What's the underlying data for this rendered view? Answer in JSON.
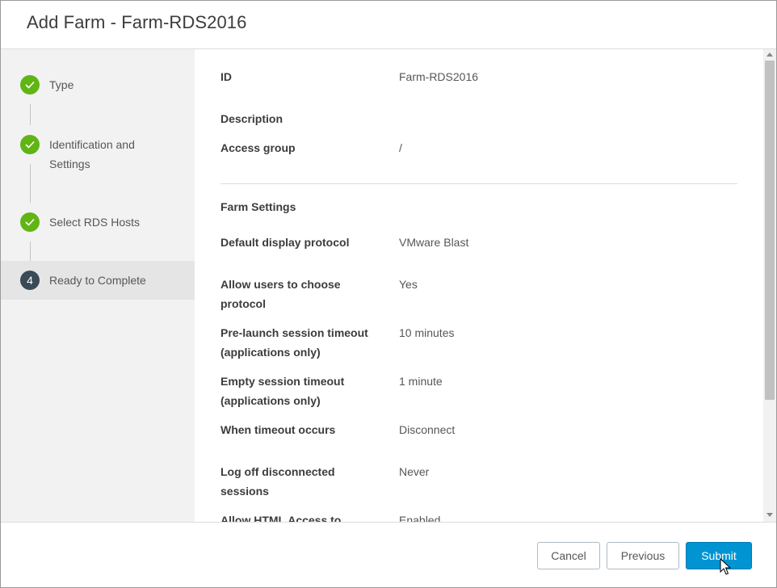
{
  "dialog": {
    "title": "Add Farm - Farm-RDS2016"
  },
  "steps": [
    {
      "label": "Type",
      "state": "done",
      "icon": "checkmark-icon"
    },
    {
      "label_line1": "Identification and",
      "label_line2": "Settings",
      "state": "done",
      "icon": "checkmark-icon"
    },
    {
      "label": "Select RDS Hosts",
      "state": "done",
      "icon": "checkmark-icon"
    },
    {
      "number": "4",
      "label": "Ready to Complete",
      "state": "current"
    }
  ],
  "summary": {
    "id_label": "ID",
    "id_value": "Farm-RDS2016",
    "description_label": "Description",
    "description_value": "",
    "access_group_label": "Access group",
    "access_group_value": "/",
    "section_title": "Farm Settings",
    "rows": [
      {
        "k1": "Default display protocol",
        "k2": "",
        "v": "VMware Blast"
      },
      {
        "k1": "Allow users to choose",
        "k2": "protocol",
        "v": "Yes"
      },
      {
        "k1": "Pre-launch session timeout",
        "k2": "(applications only)",
        "v": "10 minutes"
      },
      {
        "k1": "Empty session timeout",
        "k2": "(applications only)",
        "v": "1 minute"
      },
      {
        "k1": "When timeout occurs",
        "k2": "",
        "v": "Disconnect"
      },
      {
        "k1": "Log off disconnected",
        "k2": "sessions",
        "v": "Never"
      },
      {
        "k1": "Allow HTML Access to",
        "k2": "",
        "v": "Enabled"
      }
    ]
  },
  "footer": {
    "cancel_label": "Cancel",
    "previous_label": "Previous",
    "submit_label": "Submit"
  },
  "colors": {
    "accent": "#0094d2",
    "step_done": "#60b515",
    "step_current": "#3a4a57"
  }
}
